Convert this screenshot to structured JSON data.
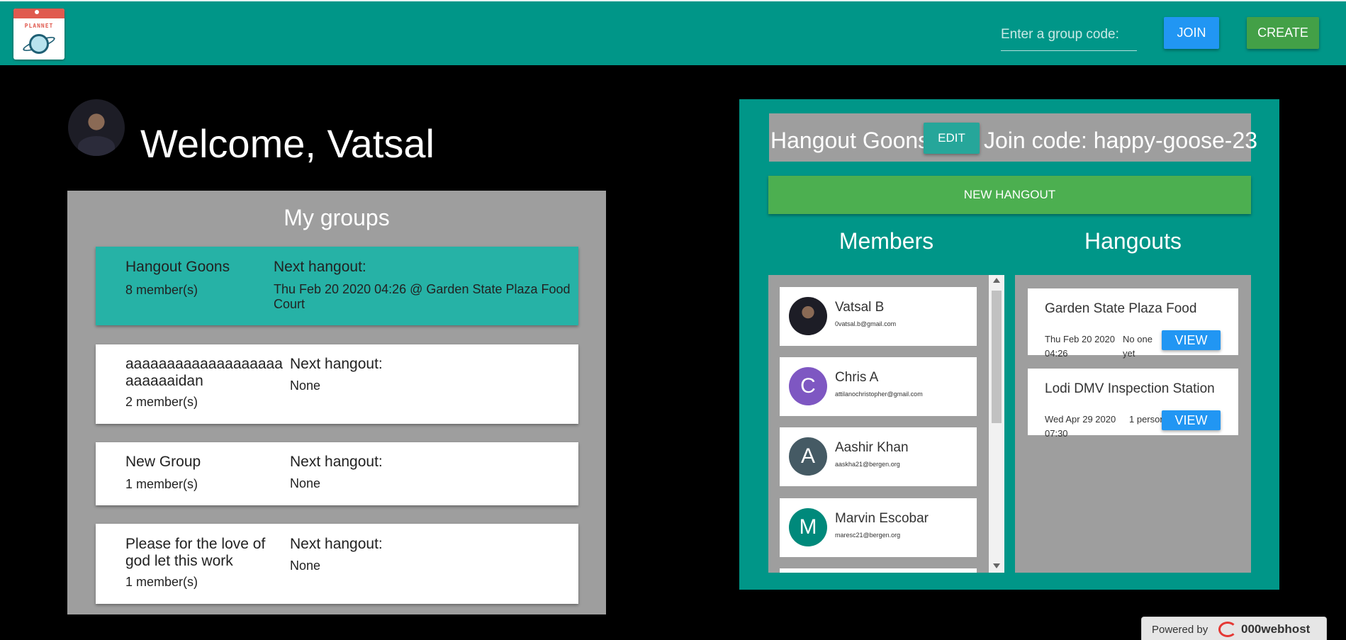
{
  "header": {
    "logo_text": "PLANNET",
    "group_code_placeholder": "Enter a group code:",
    "join_label": "JOIN",
    "create_label": "CREATE"
  },
  "welcome": {
    "text": "Welcome, Vatsal"
  },
  "groups": {
    "title": "My groups",
    "next_label": "Next hangout:",
    "items": [
      {
        "name": "Hangout Goons",
        "members": "8 member(s)",
        "next": "Thu Feb 20 2020 04:26 @ Garden State Plaza Food Court"
      },
      {
        "name": "aaaaaaaaaaaaaaaaaaaaaaaaaidan",
        "members": "2 member(s)",
        "next": "None"
      },
      {
        "name": "New Group",
        "members": "1 member(s)",
        "next": "None"
      },
      {
        "name": "Please for the love of god let this work",
        "members": "1 member(s)",
        "next": "None"
      }
    ]
  },
  "selected_group": {
    "name": "Hangout Goons",
    "edit_label": "EDIT",
    "join_code": "Join code: happy-goose-23",
    "new_hangout_label": "NEW HANGOUT",
    "members_title": "Members",
    "hangouts_title": "Hangouts",
    "members": [
      {
        "name": "Vatsal B",
        "email": "0vatsal.b@gmail.com",
        "initial": "",
        "color": "#1d1d26"
      },
      {
        "name": "Chris A",
        "email": "attilanochristopher@gmail.com",
        "initial": "C",
        "color": "#7e57c2"
      },
      {
        "name": "Aashir Khan",
        "email": "aaskha21@bergen.org",
        "initial": "A",
        "color": "#455a64"
      },
      {
        "name": "Marvin Escobar",
        "email": "maresc21@bergen.org",
        "initial": "M",
        "color": "#00897b"
      }
    ],
    "hangouts": [
      {
        "title": "Garden State Plaza Food",
        "date": "Thu Feb 20 2020 04:26",
        "people": "No one yet",
        "view_label": "VIEW"
      },
      {
        "title": "Lodi DMV Inspection Station",
        "date": "Wed Apr 29 2020 07:30",
        "people": "1 person",
        "view_label": "VIEW"
      }
    ]
  },
  "footer": {
    "powered_label": "Powered by",
    "brand": "000webhost"
  },
  "colors": {
    "teal": "#009688",
    "blue": "#2196f3",
    "green": "#4caf50",
    "gray_panel": "#9e9e9e",
    "active_card": "#26b2a6"
  }
}
